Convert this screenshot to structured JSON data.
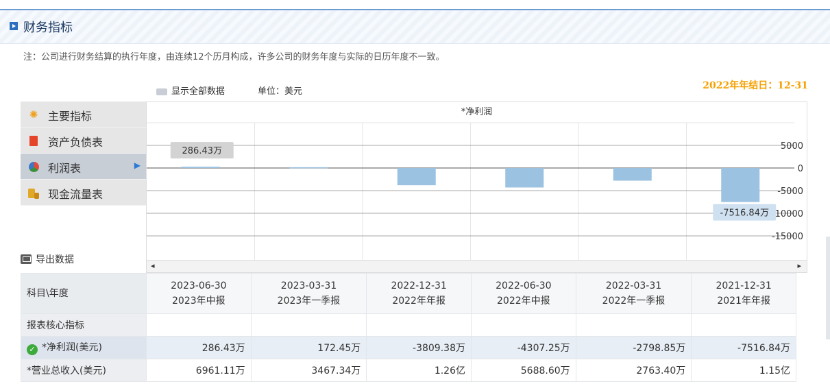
{
  "section_title": "财务指标",
  "note": "注：公司进行财务结算的执行年度，由连续12个历月构成，许多公司的财务年度与实际的日历年度不一致。",
  "year_end": "2022年年结日：12-31",
  "show_all": "显示全部数据",
  "unit": "单位：美元",
  "menu": {
    "items": [
      {
        "label": "主要指标",
        "icon": "sun-gear-icon"
      },
      {
        "label": "资产负债表",
        "icon": "document-icon"
      },
      {
        "label": "利润表",
        "icon": "pie-chart-icon"
      },
      {
        "label": "现金流量表",
        "icon": "coins-icon"
      }
    ],
    "active_index": 2
  },
  "export_label": "导出数据",
  "chart_data": {
    "type": "bar",
    "title": "*净利润",
    "categories": [
      "2023-06-30",
      "2023-03-31",
      "2022-12-31",
      "2022-06-30",
      "2022-03-31",
      "2021-12-31"
    ],
    "values": [
      286.43,
      172.45,
      -3809.38,
      -4307.25,
      -2798.85,
      -7516.84
    ],
    "ylim": [
      -15000,
      10000
    ],
    "yticks": [
      "5000",
      "0",
      "-5000",
      "10000",
      "-15000"
    ],
    "ytick_values": [
      5000,
      0,
      -5000,
      -10000,
      -15000
    ],
    "labels": [
      {
        "index": 0,
        "text": "286.43万"
      },
      {
        "index": 5,
        "text": "-7516.84万"
      }
    ],
    "bar_color": "#9bc2e0",
    "grid": true
  },
  "table": {
    "corner": "科目\\年度",
    "columns": [
      {
        "date": "2023-06-30",
        "period": "2023年中报"
      },
      {
        "date": "2023-03-31",
        "period": "2023年一季报"
      },
      {
        "date": "2022-12-31",
        "period": "2022年年报"
      },
      {
        "date": "2022-06-30",
        "period": "2022年中报"
      },
      {
        "date": "2022-03-31",
        "period": "2022年一季报"
      },
      {
        "date": "2021-12-31",
        "period": "2021年年报"
      }
    ],
    "section_row": "报表核心指标",
    "rows": [
      {
        "name": "*净利润(美元)",
        "values": [
          "286.43万",
          "172.45万",
          "-3809.38万",
          "-4307.25万",
          "-2798.85万",
          "-7516.84万"
        ],
        "checked": true
      },
      {
        "name": "*营业总收入(美元)",
        "values": [
          "6961.11万",
          "3467.34万",
          "1.26亿",
          "5688.60万",
          "2763.40万",
          "1.15亿"
        ],
        "checked": false
      }
    ]
  },
  "colors": {
    "accent": "#2d6fbf",
    "year_end": "#f5a000",
    "check": "#3cab3c"
  }
}
